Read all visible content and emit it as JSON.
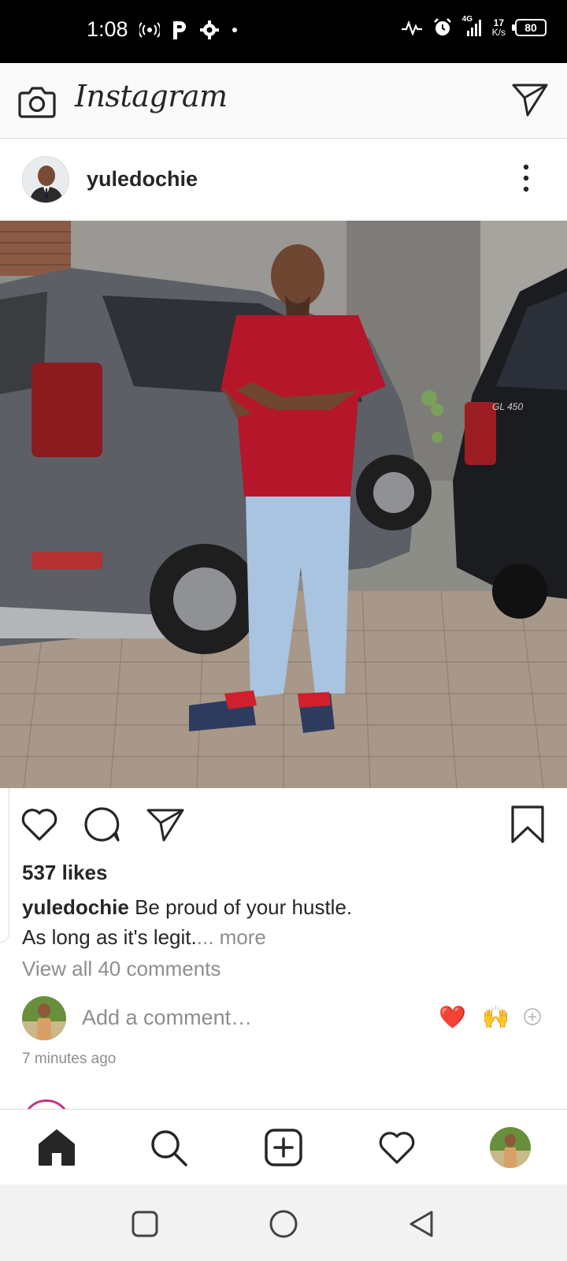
{
  "status_bar": {
    "time": "1:08",
    "network_speed_value": "17",
    "network_speed_unit": "K/s",
    "network_type": "4G",
    "battery": "80",
    "icons": [
      "hotspot-icon",
      "parking-icon",
      "gear-icon",
      "dot-icon",
      "activity-icon",
      "alarm-icon",
      "signal-icon",
      "battery-icon"
    ]
  },
  "header": {
    "logo": "Instagram",
    "camera_icon": "camera-icon",
    "direct_icon": "paper-plane-icon"
  },
  "post": {
    "username": "yuledochie",
    "likes": "537 likes",
    "caption_user": "yuledochie",
    "caption_line1": "Be proud of your hustle.",
    "caption_line2": "As long as it's legit.",
    "caption_more": "... more",
    "view_comments": "View all 40 comments",
    "add_comment_placeholder": "Add a comment…",
    "quick_reactions": [
      "❤️",
      "🙌"
    ],
    "timestamp": "7 minutes ago",
    "image_description_icon": "photo-man-red-shirt-between-suvs"
  },
  "colors": {
    "text": "#262626",
    "muted": "#8e8e8e",
    "border": "#dbdbdb",
    "heart_red": "#ed2b2b",
    "story_ring": "#c13584"
  },
  "bottom_nav": [
    "home-icon",
    "search-icon",
    "add-post-icon",
    "activity-heart-icon",
    "profile-avatar"
  ],
  "system_nav": [
    "recents-square-icon",
    "home-circle-icon",
    "back-triangle-icon"
  ]
}
